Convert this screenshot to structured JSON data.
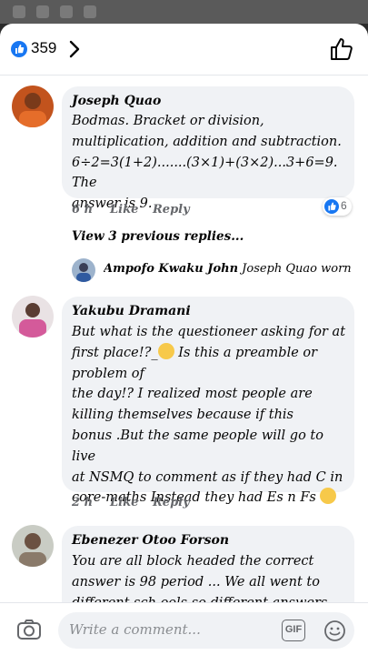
{
  "header": {
    "like_count": "359",
    "icons": [
      "like-badge-icon",
      "chevron-right-icon",
      "thumbs-up-outline-icon"
    ]
  },
  "comments": [
    {
      "author": "Joseph Quao",
      "text": "Bodmas. Bracket or division,\nmultiplication, addition and subtraction.\n6÷2=3(1+2).......(3×1)+(3×2)...3+6=9. The\nanswer is 9.",
      "time": "6 h",
      "like_label": "Like",
      "reply_label": "Reply",
      "reaction_count": "6",
      "view_previous": "View 3 previous replies...",
      "latest_reply": {
        "author": "Ampofo Kwaku John",
        "text": "Joseph Quao worng ap..."
      }
    },
    {
      "author": "Yakubu Dramani",
      "text_a": "But what is the questioneer asking for at\nfirst place!?_",
      "text_b": " Is this a preamble or\nproblem of\n the day!? I realized most people are\nkilling themselves because if this\nbonus .But the same people will go to live\nat NSMQ to comment as if they had C in\ncore-maths Instead they  had Es n Fs ",
      "time": "2 h",
      "like_label": "Like",
      "reply_label": "Reply"
    },
    {
      "author": "Ebenezer Otoo Forson",
      "text": "You are all block headed the correct\nanswer is 98 period ... We all went to\ndifferent sch ools so different answers this"
    }
  ],
  "footer": {
    "placeholder": "Write a comment...",
    "gif_label": "GIF",
    "icons": [
      "camera-icon",
      "gif-icon",
      "emoji-icon"
    ]
  }
}
